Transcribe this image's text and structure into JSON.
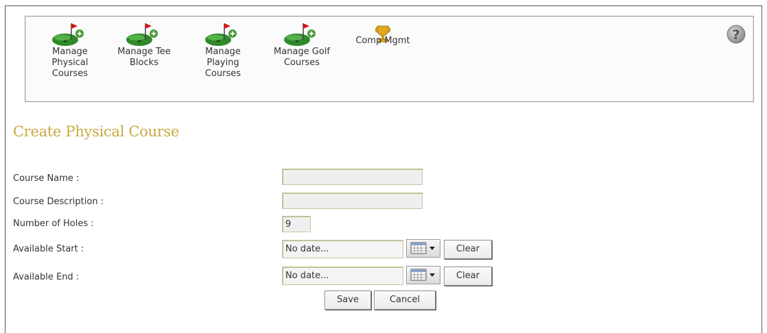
{
  "toolbar": {
    "items": [
      {
        "label": "Manage\nPhysical\nCourses",
        "icon": "golf-green-add-icon"
      },
      {
        "label": "Manage Tee\nBlocks",
        "icon": "golf-green-add-icon"
      },
      {
        "label": "Manage\nPlaying\nCourses",
        "icon": "golf-green-add-icon"
      },
      {
        "label": "Manage Golf\nCourses",
        "icon": "golf-green-add-icon"
      },
      {
        "label": "Comp Mgmt",
        "icon": "trophy-icon"
      }
    ],
    "help_icon": "help-icon"
  },
  "page": {
    "title": "Create Physical Course"
  },
  "form": {
    "course_name": {
      "label": "Course Name :",
      "value": ""
    },
    "course_description": {
      "label": "Course Description :",
      "value": ""
    },
    "number_of_holes": {
      "label": "Number of Holes :",
      "value": "9"
    },
    "available_start": {
      "label": "Available Start :",
      "value": "No date...",
      "clear_label": "Clear",
      "calendar_icon": "calendar-dropdown-icon"
    },
    "available_end": {
      "label": "Available End :",
      "value": "No date...",
      "clear_label": "Clear",
      "calendar_icon": "calendar-dropdown-icon"
    },
    "save_label": "Save",
    "cancel_label": "Cancel"
  },
  "colors": {
    "title": "#c8a843",
    "green": "#2e8b2e",
    "flag": "#cc1010"
  }
}
